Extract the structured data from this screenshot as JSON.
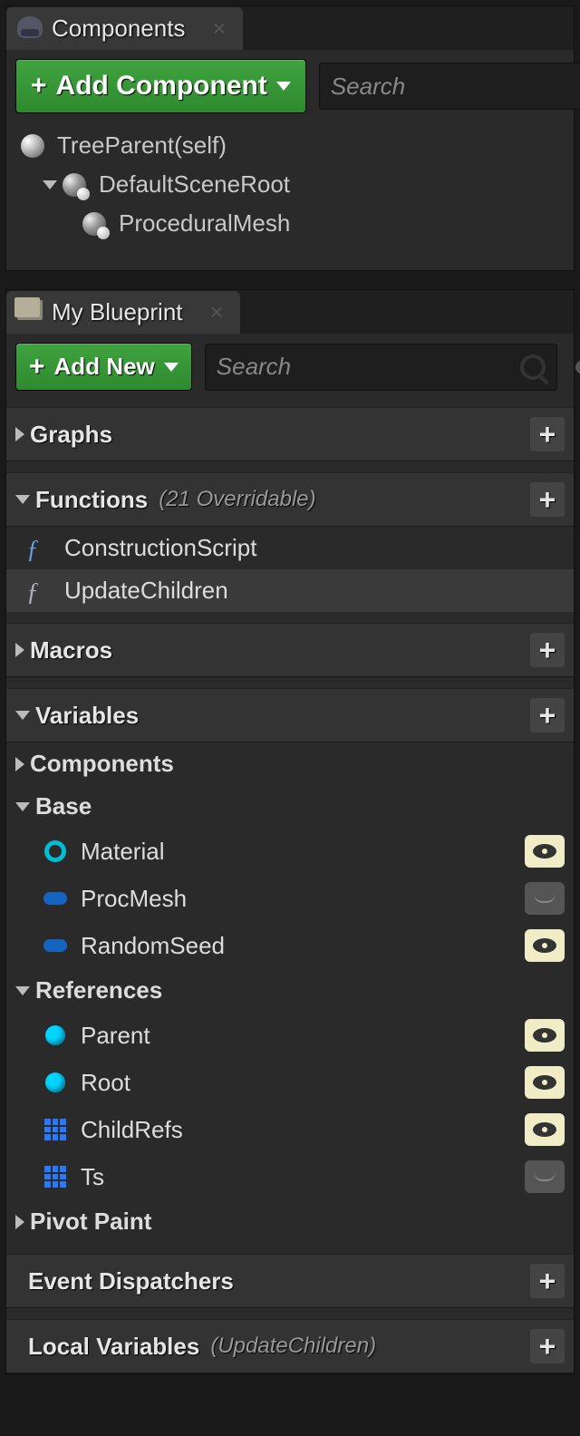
{
  "components_panel": {
    "title": "Components",
    "add_button": "Add Component",
    "search_placeholder": "Search",
    "tree": {
      "root": "TreeParent(self)",
      "scene_root": "DefaultSceneRoot",
      "child": "ProceduralMesh"
    }
  },
  "blueprint_panel": {
    "title": "My Blueprint",
    "add_button": "Add New",
    "search_placeholder": "Search",
    "sections": {
      "graphs": {
        "label": "Graphs"
      },
      "functions": {
        "label": "Functions",
        "sub": "(21 Overridable)",
        "items": [
          "ConstructionScript",
          "UpdateChildren"
        ]
      },
      "macros": {
        "label": "Macros"
      },
      "variables": {
        "label": "Variables",
        "groups": {
          "components": "Components",
          "base": {
            "label": "Base",
            "items": [
              {
                "name": "Material",
                "icon": "ring",
                "vis": "on"
              },
              {
                "name": "ProcMesh",
                "icon": "pill",
                "vis": "off"
              },
              {
                "name": "RandomSeed",
                "icon": "pill",
                "vis": "on"
              }
            ]
          },
          "references": {
            "label": "References",
            "items": [
              {
                "name": "Parent",
                "icon": "ball",
                "vis": "on"
              },
              {
                "name": "Root",
                "icon": "ball",
                "vis": "on"
              },
              {
                "name": "ChildRefs",
                "icon": "grid",
                "vis": "on"
              },
              {
                "name": "Ts",
                "icon": "grid",
                "vis": "off"
              }
            ]
          },
          "pivot": "Pivot Paint"
        }
      },
      "event_dispatchers": {
        "label": "Event Dispatchers"
      },
      "local_variables": {
        "label": "Local Variables",
        "sub": "(UpdateChildren)"
      }
    }
  }
}
